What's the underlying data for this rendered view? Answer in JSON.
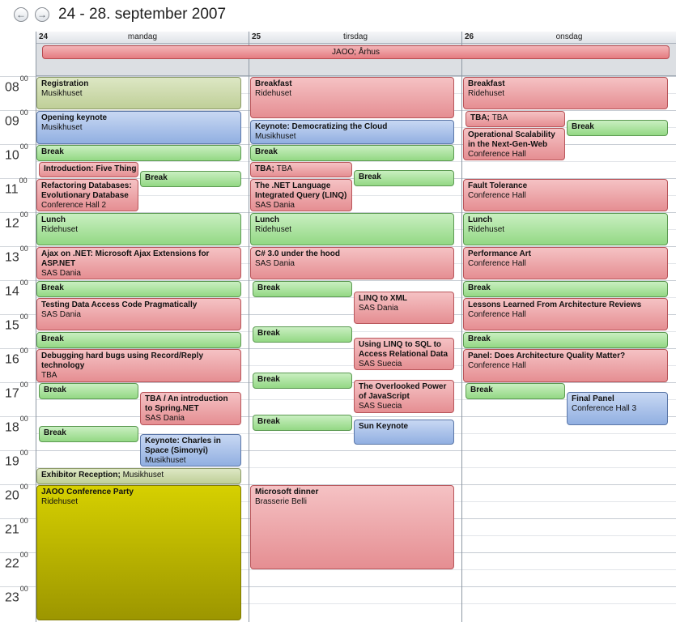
{
  "header": {
    "back_icon": "arrow-left-icon",
    "forward_icon": "arrow-right-icon",
    "title": "24 - 28. september 2007"
  },
  "hours": [
    "08",
    "09",
    "10",
    "11",
    "12",
    "13",
    "14",
    "15",
    "16",
    "17",
    "18",
    "19",
    "20",
    "21",
    "22",
    "23"
  ],
  "minutes": "00",
  "days": [
    {
      "num": "24",
      "name": "mandag"
    },
    {
      "num": "25",
      "name": "tirsdag"
    },
    {
      "num": "26",
      "name": "onsdag"
    }
  ],
  "allday": {
    "title": "JAOO; Århus"
  },
  "events": {
    "mon": [
      {
        "title": "Registration",
        "loc": "Musikhuset",
        "color": "olive"
      },
      {
        "title": "Opening keynote",
        "loc": "Musikhuset",
        "color": "blue"
      },
      {
        "title": "Break",
        "loc": "",
        "color": "green"
      },
      {
        "title": "Introduction: Five Thing",
        "loc": "",
        "color": "red"
      },
      {
        "title": "Break",
        "loc": "",
        "color": "green"
      },
      {
        "title": "Refactoring Databases: Evolutionary Database",
        "loc": "Conference Hall 2",
        "color": "red"
      },
      {
        "title": "Lunch",
        "loc": "Ridehuset",
        "color": "green"
      },
      {
        "title": "Ajax on .NET: Microsoft Ajax Extensions for ASP.NET",
        "loc": "SAS Dania",
        "color": "red"
      },
      {
        "title": "Break",
        "loc": "",
        "color": "green"
      },
      {
        "title": "Testing Data Access Code Pragmatically",
        "loc": "SAS Dania",
        "color": "red"
      },
      {
        "title": "Break",
        "loc": "",
        "color": "green"
      },
      {
        "title": "Debugging hard bugs using Record/Reply technology",
        "loc": "TBA",
        "color": "red"
      },
      {
        "title": "Break",
        "loc": "",
        "color": "green"
      },
      {
        "title": "TBA / An introduction to Spring.NET",
        "loc": "SAS Dania",
        "color": "red"
      },
      {
        "title": "Break",
        "loc": "",
        "color": "green"
      },
      {
        "title": "Keynote: Charles in Space (Simonyi)",
        "loc": "Musikhuset",
        "color": "blue"
      },
      {
        "title": "Exhibitor Reception;",
        "loc": "Musikhuset",
        "color": "olive"
      },
      {
        "title": "JAOO Conference Party",
        "loc": "Ridehuset",
        "color": "yellow"
      }
    ],
    "tue": [
      {
        "title": "Breakfast",
        "loc": "Ridehuset",
        "color": "red"
      },
      {
        "title": "Keynote: Democratizing the Cloud",
        "loc": "Musikhuset",
        "color": "blue"
      },
      {
        "title": "Break",
        "loc": "",
        "color": "green"
      },
      {
        "title": "TBA;",
        "loc": "TBA",
        "color": "red"
      },
      {
        "title": "Break",
        "loc": "",
        "color": "green"
      },
      {
        "title": "The .NET Language Integrated Query (LINQ)",
        "loc": "SAS Dania",
        "color": "red"
      },
      {
        "title": "Lunch",
        "loc": "Ridehuset",
        "color": "green"
      },
      {
        "title": "C# 3.0 under the hood",
        "loc": "SAS Dania",
        "color": "red"
      },
      {
        "title": "Break",
        "loc": "",
        "color": "green"
      },
      {
        "title": "LINQ to XML",
        "loc": "SAS Dania",
        "color": "red"
      },
      {
        "title": "Break",
        "loc": "",
        "color": "green"
      },
      {
        "title": "Using LINQ to SQL to Access Relational Data",
        "loc": "SAS Suecia",
        "color": "red"
      },
      {
        "title": "Break",
        "loc": "",
        "color": "green"
      },
      {
        "title": "The Overlooked Power of JavaScript",
        "loc": "SAS Suecia",
        "color": "red"
      },
      {
        "title": "Break",
        "loc": "",
        "color": "green"
      },
      {
        "title": "Sun Keynote",
        "loc": "",
        "color": "blue"
      },
      {
        "title": "Microsoft dinner",
        "loc": "Brasserie Belli",
        "color": "red"
      }
    ],
    "wed": [
      {
        "title": "Breakfast",
        "loc": "Ridehuset",
        "color": "red"
      },
      {
        "title": "TBA;",
        "loc": "TBA",
        "color": "red"
      },
      {
        "title": "Break",
        "loc": "",
        "color": "green"
      },
      {
        "title": "Operational Scalability in the Next-Gen-Web",
        "loc": "Conference Hall",
        "color": "red"
      },
      {
        "title": "Fault Tolerance",
        "loc": "Conference Hall",
        "color": "red"
      },
      {
        "title": "Lunch",
        "loc": "Ridehuset",
        "color": "green"
      },
      {
        "title": "Performance Art",
        "loc": "Conference Hall",
        "color": "red"
      },
      {
        "title": "Break",
        "loc": "",
        "color": "green"
      },
      {
        "title": "Lessons Learned From Architecture Reviews",
        "loc": "Conference Hall",
        "color": "red"
      },
      {
        "title": "Break",
        "loc": "",
        "color": "green"
      },
      {
        "title": "Panel: Does Architecture Quality Matter?",
        "loc": "Conference Hall",
        "color": "red"
      },
      {
        "title": "Break",
        "loc": "",
        "color": "green"
      },
      {
        "title": "Final Panel",
        "loc": "Conference Hall 3",
        "color": "blue"
      }
    ]
  }
}
